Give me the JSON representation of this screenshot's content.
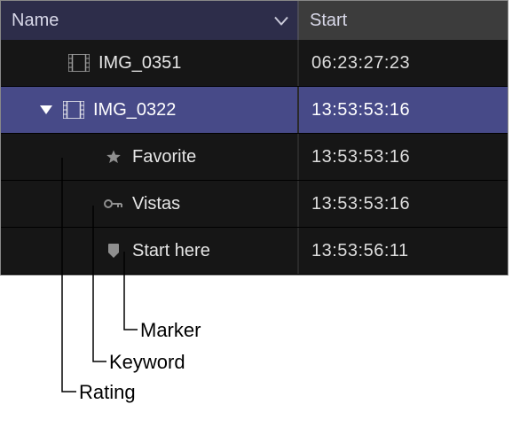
{
  "columns": {
    "name": "Name",
    "start": "Start"
  },
  "rows": [
    {
      "type": "clip",
      "indent": 1,
      "icon": "film-icon",
      "label": "IMG_0351",
      "start": "06:23:27:23",
      "selected": false,
      "disclosure": null
    },
    {
      "type": "clip",
      "indent": 1,
      "icon": "film-icon",
      "label": "IMG_0322",
      "start": "13:53:53:16",
      "selected": true,
      "disclosure": "open"
    },
    {
      "type": "rating",
      "indent": 2,
      "icon": "star-icon",
      "label": "Favorite",
      "start": "13:53:53:16",
      "selected": false
    },
    {
      "type": "keyword",
      "indent": 2,
      "icon": "key-icon",
      "label": "Vistas",
      "start": "13:53:53:16",
      "selected": false
    },
    {
      "type": "marker",
      "indent": 2,
      "icon": "marker-icon",
      "label": "Start here",
      "start": "13:53:56:11",
      "selected": false
    }
  ],
  "callouts": {
    "marker": "Marker",
    "keyword": "Keyword",
    "rating": "Rating"
  }
}
